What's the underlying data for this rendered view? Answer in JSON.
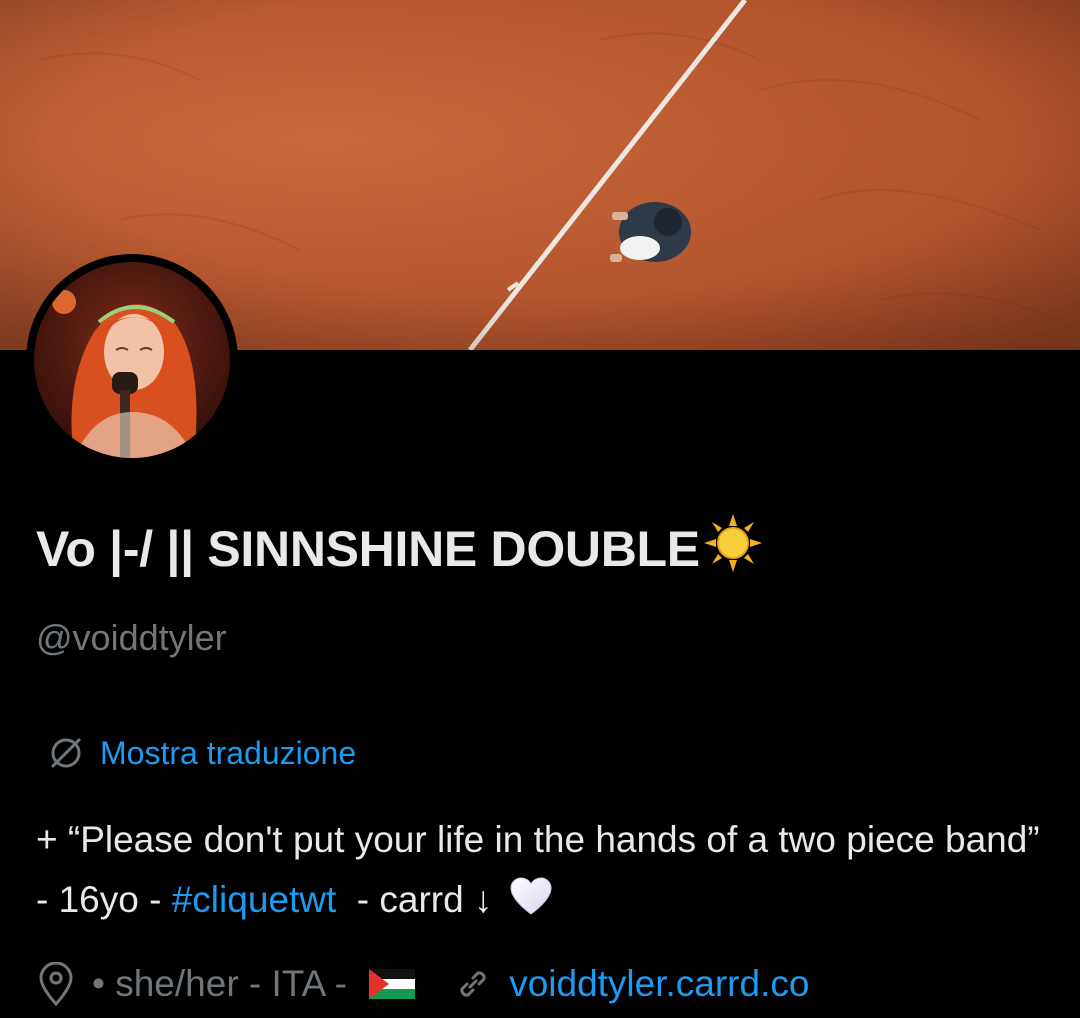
{
  "profile": {
    "display_name": "Vo |-/ || SINNSHINE DOUBLE",
    "name_emoji": "sun-emoji",
    "handle": "@voiddtyler",
    "translate_label": "Mostra traduzione",
    "bio": {
      "part1": "+ “Please don't put your life in the hands of a two piece band” - 16yo - ",
      "hashtag": "#cliquetwt",
      "part2": "  - carrd ↓ ",
      "end_emoji": "white-heart-emoji"
    },
    "location": "• she/her - ITA - ",
    "location_flag": "palestine-flag",
    "website": "voiddtyler.carrd.co"
  },
  "colors": {
    "background": "#000000",
    "text": "#e7e9ea",
    "muted": "#71767b",
    "accent": "#1d9bf0",
    "banner_clay": "#b95a31"
  },
  "icons": {
    "translate": "translate-globe-icon",
    "location": "location-pin-icon",
    "link": "link-icon"
  }
}
